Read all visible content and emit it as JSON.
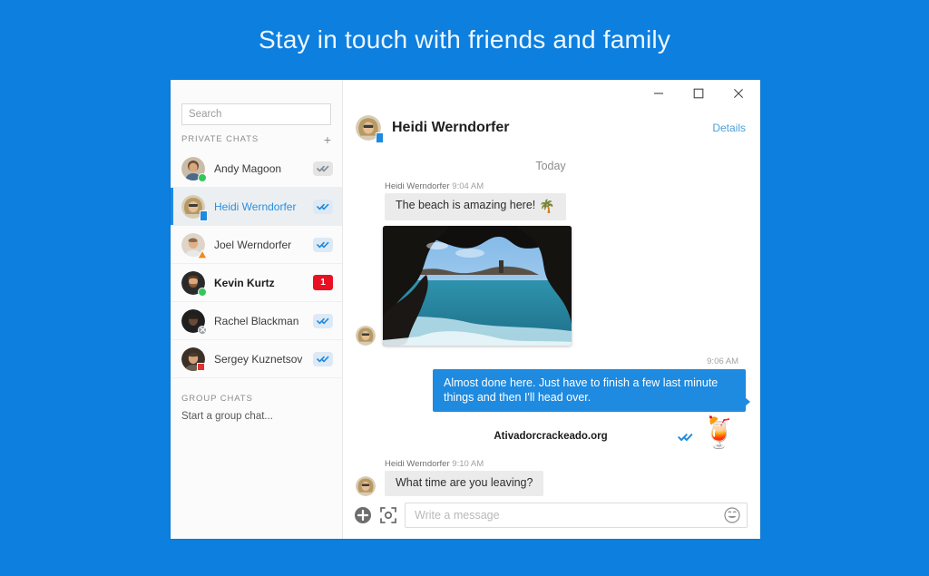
{
  "promo": {
    "title": "Stay in touch with friends and family"
  },
  "colors": {
    "background_blue": "#0c7fdf",
    "accent_blue": "#1e8ae0",
    "link_blue": "#4e9fd8",
    "unread_red": "#e81123",
    "available_green": "#35c65b",
    "away_orange": "#f08a24",
    "busy_red": "#e33131",
    "bubble_in_gray": "#ebebeb"
  },
  "window_controls": {
    "minimize": "minimize-icon",
    "maximize": "maximize-icon",
    "close": "close-icon"
  },
  "sidebar": {
    "search": {
      "value": "",
      "placeholder": "Search"
    },
    "private_chats": {
      "label": "PRIVATE CHATS",
      "add_label": "+",
      "items": [
        {
          "name": "Andy Magoon",
          "presence": "available",
          "badge_type": "check",
          "badge_style": "gray",
          "selected": false,
          "unread": false
        },
        {
          "name": "Heidi Werndorfer",
          "presence": "mobile",
          "badge_type": "check",
          "badge_style": "blue",
          "selected": true,
          "unread": false
        },
        {
          "name": "Joel Werndorfer",
          "presence": "away",
          "badge_type": "check",
          "badge_style": "blue",
          "selected": false,
          "unread": false
        },
        {
          "name": "Kevin Kurtz",
          "presence": "available",
          "badge_type": "count",
          "badge_count": "1",
          "selected": false,
          "unread": true
        },
        {
          "name": "Rachel Blackman",
          "presence": "offline",
          "badge_type": "check",
          "badge_style": "blue",
          "selected": false,
          "unread": false
        },
        {
          "name": "Sergey Kuznetsov",
          "presence": "busy",
          "badge_type": "check",
          "badge_style": "blue",
          "selected": false,
          "unread": false
        }
      ]
    },
    "group_chats": {
      "label": "GROUP CHATS",
      "start_label": "Start a group chat..."
    }
  },
  "conversation": {
    "contact_name": "Heidi Werndorfer",
    "details_label": "Details",
    "day_separator": "Today",
    "messages": [
      {
        "direction": "in",
        "sender": "Heidi Werndorfer",
        "time": "9:04 AM",
        "text": "The beach is amazing here!",
        "emoji": "🌴"
      },
      {
        "direction": "in",
        "type": "photo",
        "caption": "sea-cave-beach-photo"
      },
      {
        "direction": "out",
        "time": "9:06 AM",
        "text": "Almost done here. Just have to finish a few last minute things and then I'll head over."
      },
      {
        "direction": "out",
        "type": "sticker",
        "emoji": "🍹",
        "receipt": "read"
      },
      {
        "direction": "in",
        "sender": "Heidi Werndorfer",
        "time": "9:10 AM",
        "text": "What time are you leaving?"
      }
    ],
    "watermark": "Ativadorcrackeado.org",
    "composer": {
      "add_icon": "plus-circle-icon",
      "camera_icon": "camera-icon",
      "input_value": "",
      "input_placeholder": "Write a message",
      "emoji_icon": "smiley-icon"
    }
  }
}
